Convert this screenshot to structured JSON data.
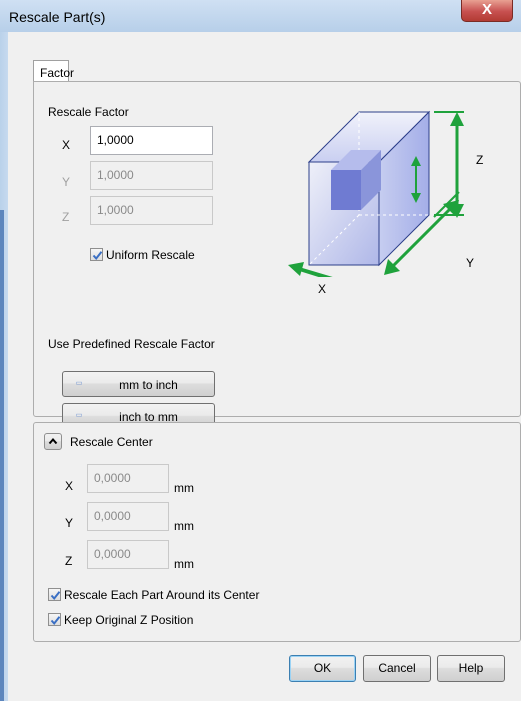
{
  "window": {
    "title": "Rescale Part(s)",
    "close_glyph": "X"
  },
  "tab": {
    "label": "Factor"
  },
  "factor": {
    "heading": "Rescale Factor",
    "x_label": "X",
    "x_value": "1,0000",
    "y_label": "Y",
    "y_value": "1,0000",
    "z_label": "Z",
    "z_value": "1,0000",
    "uniform_label": "Uniform Rescale",
    "uniform_checked": true
  },
  "diagram": {
    "x": "X",
    "y": "Y",
    "z": "Z",
    "icon": "rescale-box-diagram"
  },
  "predefined": {
    "heading": "Use Predefined Rescale Factor",
    "mm_to_inch": "mm to inch",
    "inch_to_mm": "inch to mm"
  },
  "center": {
    "heading": "Rescale Center",
    "x_label": "X",
    "x_value": "0,0000",
    "x_unit": "mm",
    "y_label": "Y",
    "y_value": "0,0000",
    "y_unit": "mm",
    "z_label": "Z",
    "z_value": "0,0000",
    "z_unit": "mm",
    "each_part_label": "Rescale Each Part Around its Center",
    "keep_z_label": "Keep Original Z Position"
  },
  "buttons": {
    "ok": "OK",
    "cancel": "Cancel",
    "help": "Help"
  },
  "colors": {
    "accent_green": "#1fa23c",
    "box_blue": "#7a8ce0",
    "title_blue": "#b9d1ea"
  }
}
